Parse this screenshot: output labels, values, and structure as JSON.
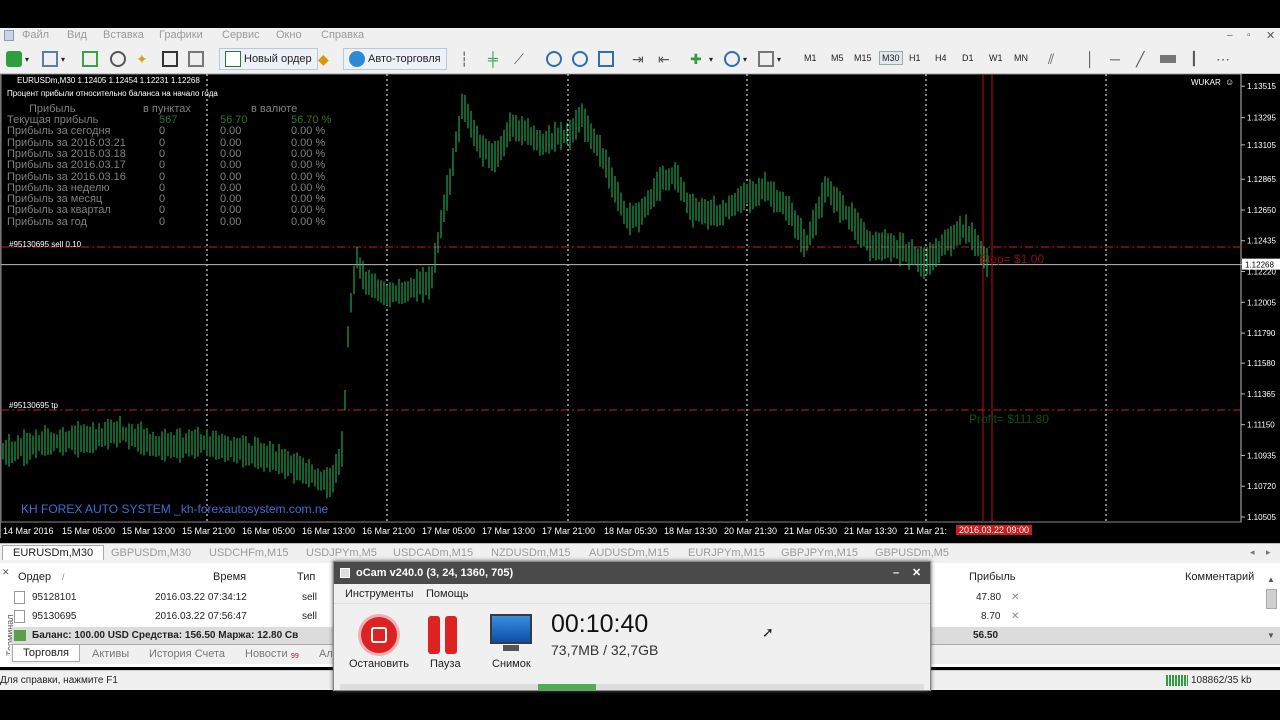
{
  "menu": [
    "Файл",
    "Вид",
    "Вставка",
    "Графики",
    "Сервис",
    "Окно",
    "Справка"
  ],
  "toolbar": {
    "new_order": "Новый ордер",
    "autotrade": "Авто-торговля",
    "timeframes": [
      "M1",
      "M5",
      "M15",
      "M30",
      "H1",
      "H4",
      "D1",
      "W1",
      "MN"
    ]
  },
  "chart": {
    "header": "EURUSDm,M30  1.12405 1.12454 1.12231 1.12268",
    "subtitle": "Процент прибыли относительно баланса на начало года",
    "col_headers": [
      "Прибыль",
      "в пунктах",
      "в валюте"
    ],
    "rows": [
      {
        "label": "Текущая прибыль",
        "pts": "567",
        "cur": "56.70",
        "pct": "56.70 %"
      },
      {
        "label": "Прибыль за сегодня",
        "pts": "0",
        "cur": "0.00",
        "pct": "0.00 %"
      },
      {
        "label": "Прибыль за 2016.03.21",
        "pts": "0",
        "cur": "0.00",
        "pct": "0.00 %"
      },
      {
        "label": "Прибыль за 2016.03.18",
        "pts": "0",
        "cur": "0.00",
        "pct": "0.00 %"
      },
      {
        "label": "Прибыль за 2016.03.17",
        "pts": "0",
        "cur": "0.00",
        "pct": "0.00 %"
      },
      {
        "label": "Прибыль за 2016.03.16",
        "pts": "0",
        "cur": "0.00",
        "pct": "0.00 %"
      },
      {
        "label": "Прибыль за неделю",
        "pts": "0",
        "cur": "0.00",
        "pct": "0.00 %"
      },
      {
        "label": "Прибыль за месяц",
        "pts": "0",
        "cur": "0.00",
        "pct": "0.00 %"
      },
      {
        "label": "Прибыль за квартал",
        "pts": "0",
        "cur": "0.00",
        "pct": "0.00 %"
      },
      {
        "label": "Прибыль за год",
        "pts": "0",
        "cur": "0.00",
        "pct": "0.00 %"
      }
    ],
    "order_sell": "#95130695 sell 0.10",
    "order_tp": "#95130695 tp",
    "stop_label": "Stop= $1.00",
    "profit_label": "Profit= $111.80",
    "watermark": "KH FOREX AUTO SYSTEM  _kh-forexautosystem.com.ne",
    "corner_label": "WUKAR",
    "prices": [
      "1.13515",
      "1.13295",
      "1.13105",
      "1.12865",
      "1.12650",
      "1.12435",
      "1.12268",
      "1.12220",
      "1.12005",
      "1.11790",
      "1.11580",
      "1.11365",
      "1.11150",
      "1.10935",
      "1.10720",
      "1.10505"
    ],
    "times": [
      "14 Mar 2016",
      "15 Mar 05:00",
      "15 Mar 13:00",
      "15 Mar 21:00",
      "16 Mar 05:00",
      "16 Mar 13:00",
      "16 Mar 21:00",
      "17 Mar 05:00",
      "17 Mar 13:00",
      "17 Mar 21:00",
      "18 Mar 05:30",
      "18 Mar 13:30",
      "20 Mar 21:30",
      "21 Mar 05:30",
      "21 Mar 13:30",
      "21 Mar 21:"
    ],
    "current_time": "2016.03.22 09:00",
    "colors": {
      "candle": "#22c55e",
      "grid": "#ffffff",
      "order_line": "#c81e1e"
    }
  },
  "symbol_tabs": [
    "EURUSDm,M30",
    "GBPUSDm,M30",
    "USDCHFm,M15",
    "USDJPYm,M5",
    "USDCADm,M15",
    "NZDUSDm,M15",
    "AUDUSDm,M15",
    "EURJPYm,M15",
    "GBPJPYm,M15",
    "GBPUSDm,M5"
  ],
  "terminal": {
    "headers": {
      "order": "Ордер",
      "time": "Время",
      "type": "Тип",
      "profit": "Прибыль",
      "comment": "Комментарий"
    },
    "orders": [
      {
        "id": "95128101",
        "time": "2016.03.22 07:34:12",
        "type": "sell",
        "profit": "47.80"
      },
      {
        "id": "95130695",
        "time": "2016.03.22 07:56:47",
        "type": "sell",
        "profit": "8.70"
      }
    ],
    "balance": "Баланс: 100.00 USD  Средства: 156.50  Маржа: 12.80  Св",
    "balance_profit": "56.50",
    "side_label": "Терминал",
    "tabs": [
      "Торговля",
      "Активы",
      "История Счета",
      "Новости",
      "Ал"
    ],
    "news_badge": "99"
  },
  "status": {
    "help": "Для справки, нажмите F1",
    "traffic": "108862/35 kb"
  },
  "ocam": {
    "title": "oCam v240.0 (3, 24, 1360, 705)",
    "menu": [
      "Инструменты",
      "Помощь"
    ],
    "stop": "Остановить",
    "pause": "Пауза",
    "snapshot": "Снимок",
    "timer": "00:10:40",
    "size": "73,7MB / 32,7GB"
  }
}
